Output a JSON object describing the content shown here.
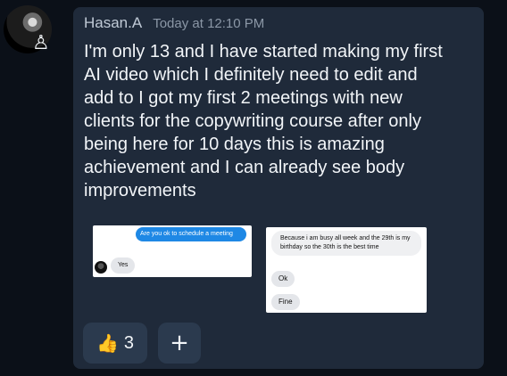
{
  "message": {
    "author": "Hasan.A",
    "timestamp": "Today at 12:10 PM",
    "text": "I'm only 13 and I have started making my first\nAI video which I definitely need to edit and\nadd to I got my first 2 meetings with new\nclients for the copywriting course after only\nbeing here for 10 days this is amazing\nachievement and I can already see body\nimprovements",
    "avatar_badge_icon": "person-icon"
  },
  "attachments": [
    {
      "bubble_question": "Are you ok to schedule a meeting",
      "reply_yes": "Yes"
    },
    {
      "reply_long": "Because i am busy all week and the 29th is my birthday so the 30th is the best time",
      "reply_ok": "Ok",
      "reply_fine": "Fine"
    }
  ],
  "reactions": {
    "like_icon": "thumbs-up-icon",
    "like_count": "3",
    "add_reaction_label": "+"
  }
}
